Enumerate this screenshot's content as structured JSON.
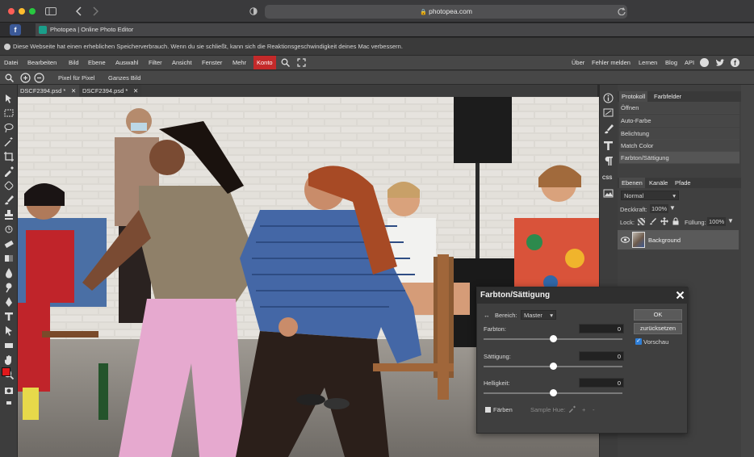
{
  "browser": {
    "url": "photopea.com",
    "tab_title": "Photopea | Online Photo Editor"
  },
  "notice": "Diese Webseite hat einen erheblichen Speicherverbrauch. Wenn du sie schließt, kann sich die Reaktionsgeschwindigkeit deines Mac verbessern.",
  "menu": {
    "items": [
      "Datei",
      "Bearbeiten",
      "Bild",
      "Ebene",
      "Auswahl",
      "Filter",
      "Ansicht",
      "Fenster",
      "Mehr"
    ],
    "konto": "Konto",
    "right": [
      "Über",
      "Fehler melden",
      "Lernen",
      "Blog",
      "API"
    ]
  },
  "options": {
    "pixel": "Pixel für Pixel",
    "full": "Ganzes Bild"
  },
  "doc_tabs": [
    "DSCF2394.psd *",
    "DSCF2394.psd *"
  ],
  "panels": {
    "history_tabs": [
      "Protokoll",
      "Farbfelder"
    ],
    "history": [
      "Öffnen",
      "Auto-Farbe",
      "Belichtung",
      "Match Color",
      "Farbton/Sättigung"
    ],
    "layer_tabs": [
      "Ebenen",
      "Kanäle",
      "Pfade"
    ],
    "blend_mode": "Normal",
    "opacity_label": "Deckkraft:",
    "opacity_value": "100%",
    "lock_label": "Lock:",
    "fill_label": "Füllung:",
    "fill_value": "100%",
    "layer_name": "Background"
  },
  "dialog": {
    "title": "Farbton/Sättigung",
    "range_label": "Bereich:",
    "range_value": "Master",
    "hue_label": "Farbton:",
    "hue_value": "0",
    "hue_level": 0.5,
    "sat_label": "Sättigung:",
    "sat_value": "0",
    "sat_level": 0.5,
    "light_label": "Helligkeit:",
    "light_value": "0",
    "light_level": 0.5,
    "ok": "OK",
    "reset": "zurücksetzen",
    "preview": "Vorschau",
    "colorize": "Färben",
    "sample_hue": "Sample Hue:",
    "plus": "+",
    "minus": "-"
  },
  "colors": {
    "foreground": "#e0191b",
    "background": "#ffffff",
    "accent": "#c42a2a"
  },
  "icons": {
    "close": "close-icon",
    "eye": "eye-icon",
    "search": "search-icon",
    "fullscreen": "fullscreen-icon"
  }
}
